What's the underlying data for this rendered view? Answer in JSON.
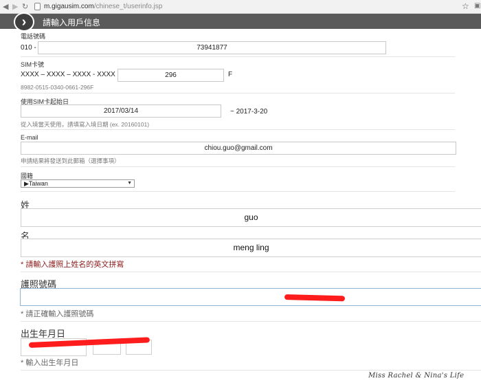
{
  "browser": {
    "url_domain": "m.gigausim.com",
    "url_path": "/chinese_t/userinfo.jsp"
  },
  "header": {
    "title": "請輸入用戶信息"
  },
  "phone": {
    "label": "電話號碼",
    "prefix": "010 -",
    "value": "73941877"
  },
  "sim": {
    "label": "SIM卡號",
    "prefix": "XXXX – XXXX – XXXX - XXXX -",
    "value": "296",
    "suffix": "F",
    "hint": "8982-0515-0340-0661-296F"
  },
  "start_date": {
    "label": "使用SIM卡起始日",
    "value": "2017/03/14",
    "end_text": "~ 2017-3-20",
    "hint": "從入境當天使用，請填寫入境日期 (ex. 20160101)"
  },
  "email": {
    "label": "E-mail",
    "value": "chiou.guo@gmail.com",
    "hint": "申請結果將發送到此郵箱（選擇事項）"
  },
  "nationality": {
    "label": "國籍",
    "selected": "▶Taiwan"
  },
  "surname": {
    "label": "姓",
    "value": "guo"
  },
  "given_name": {
    "label": "名",
    "value": "meng ling",
    "error": "* 請輸入護照上姓名的英文拼寫"
  },
  "passport": {
    "label": "護照號碼",
    "hint": "* 請正確輸入護照號碼"
  },
  "birthdate": {
    "label": "出生年月日",
    "hint": "* 輸入出生年月日"
  },
  "watermark": "Miss Rachel & Nina's Life",
  "colors": {
    "header_bg": "#5a5a5a",
    "error_text": "#8a1c1c",
    "redaction": "#ff1c1c"
  }
}
